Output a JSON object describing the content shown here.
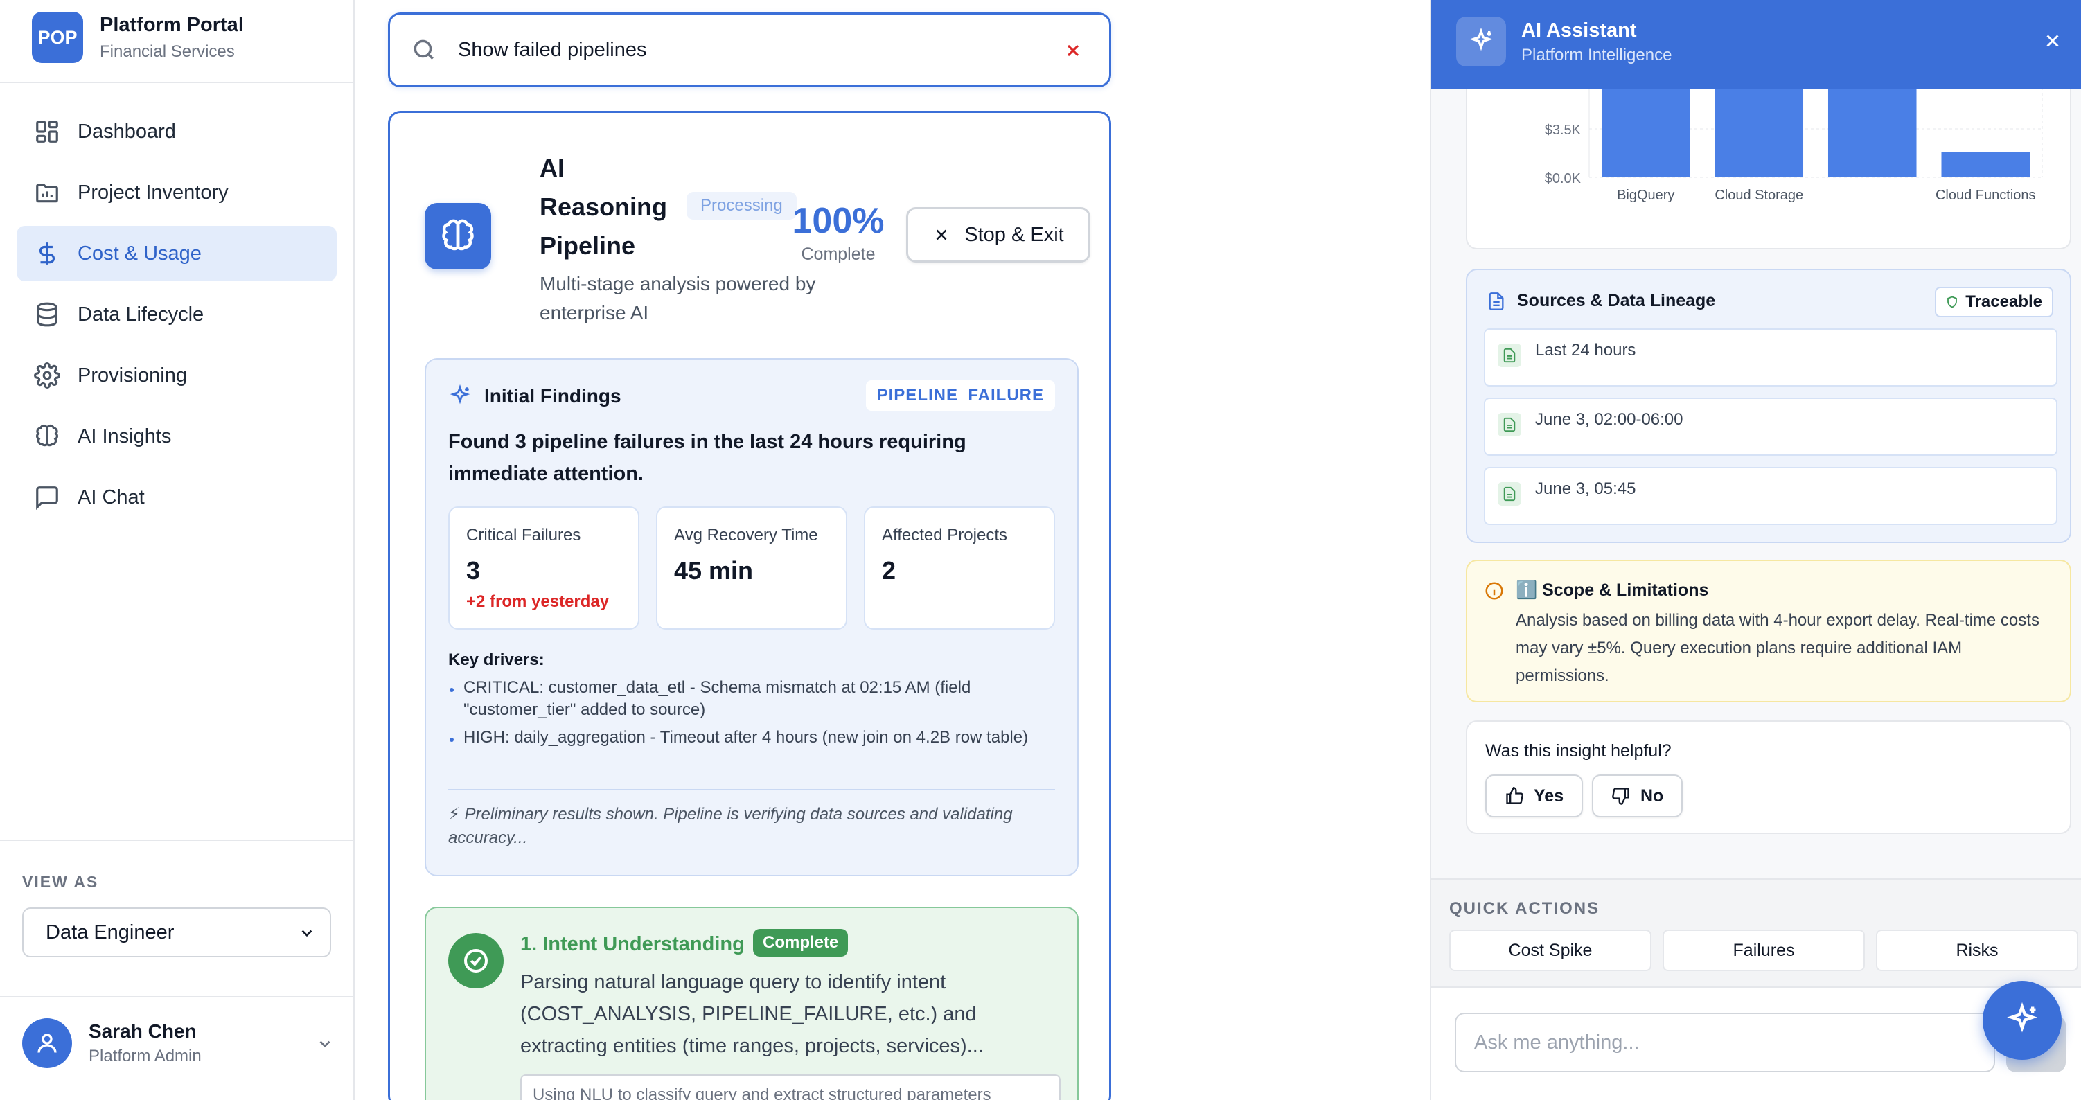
{
  "brand": {
    "logo": "POP",
    "title": "Platform Portal",
    "subtitle": "Financial Services"
  },
  "nav": [
    {
      "label": "Dashboard",
      "icon": "dashboard-icon",
      "active": false
    },
    {
      "label": "Project Inventory",
      "icon": "folder-icon",
      "active": false
    },
    {
      "label": "Cost & Usage",
      "icon": "dollar-icon",
      "active": true
    },
    {
      "label": "Data Lifecycle",
      "icon": "database-icon",
      "active": false
    },
    {
      "label": "Provisioning",
      "icon": "gear-icon",
      "active": false
    },
    {
      "label": "AI Insights",
      "icon": "brain-icon",
      "active": false
    },
    {
      "label": "AI Chat",
      "icon": "chat-icon",
      "active": false
    }
  ],
  "view_as": {
    "label": "VIEW AS",
    "selected": "Data Engineer"
  },
  "user": {
    "name": "Sarah Chen",
    "role": "Platform Admin"
  },
  "search": {
    "query": "Show failed pipelines"
  },
  "pipeline": {
    "title": "AI Reasoning Pipeline",
    "status": "Processing",
    "subtitle": "Multi-stage analysis powered by enterprise AI",
    "progress_value": "100%",
    "progress_label": "Complete",
    "stop_label": "Stop & Exit"
  },
  "findings": {
    "title": "Initial Findings",
    "tag": "PIPELINE_FAILURE",
    "summary": "Found 3 pipeline failures in the last 24 hours requiring immediate attention.",
    "stats": [
      {
        "label": "Critical Failures",
        "value": "3",
        "note": "+2 from yesterday"
      },
      {
        "label": "Avg Recovery Time",
        "value": "45 min",
        "note": ""
      },
      {
        "label": "Affected Projects",
        "value": "2",
        "note": ""
      }
    ],
    "drivers_label": "Key drivers:",
    "drivers": [
      "CRITICAL: customer_data_etl - Schema mismatch at 02:15 AM (field \"customer_tier\" added to source)",
      "HIGH: daily_aggregation - Timeout after 4 hours (new join on 4.2B row table)"
    ],
    "preliminary": "⚡ Preliminary results shown. Pipeline is verifying data sources and validating accuracy..."
  },
  "step1": {
    "title": "1. Intent Understanding",
    "badge": "Complete",
    "description": "Parsing natural language query to identify intent (COST_ANALYSIS, PIPELINE_FAILURE, etc.) and extracting entities (time ranges, projects, services)...",
    "detail": "Using NLU to classify query and extract structured parameters"
  },
  "assistant": {
    "title": "AI Assistant",
    "subtitle": "Platform Intelligence",
    "close_icon": "close-icon"
  },
  "chart_data": {
    "type": "bar",
    "categories": [
      "BigQuery",
      "Cloud Storage",
      "",
      "Cloud Functions"
    ],
    "category_labels_shown": [
      "BigQuery",
      "Cloud Storage",
      "Cloud Functions"
    ],
    "values": [
      12000,
      11000,
      9000,
      1800
    ],
    "y_ticks": [
      "$0.0K",
      "$3.5K"
    ],
    "ylim": [
      0,
      5000
    ],
    "color": "#4a7fe6",
    "partially_scrolled": true
  },
  "lineage": {
    "title": "Sources & Data Lineage",
    "badge": "Traceable",
    "items": [
      "Last 24 hours",
      "June 3, 02:00-06:00",
      "June 3, 05:45"
    ]
  },
  "scope": {
    "title": "ℹ️ Scope & Limitations",
    "text": "Analysis based on billing data with 4-hour export delay. Real-time costs may vary ±5%. Query execution plans require additional IAM permissions."
  },
  "feedback": {
    "question": "Was this insight helpful?",
    "yes": "Yes",
    "no": "No"
  },
  "quick_actions": {
    "label": "QUICK ACTIONS",
    "items": [
      "Cost Spike",
      "Failures",
      "Risks"
    ]
  },
  "chat": {
    "placeholder": "Ask me anything..."
  },
  "colors": {
    "primary": "#3b6fd8",
    "success": "#3f9a56",
    "danger": "#dc2626",
    "warning_bg": "#fefbea"
  }
}
